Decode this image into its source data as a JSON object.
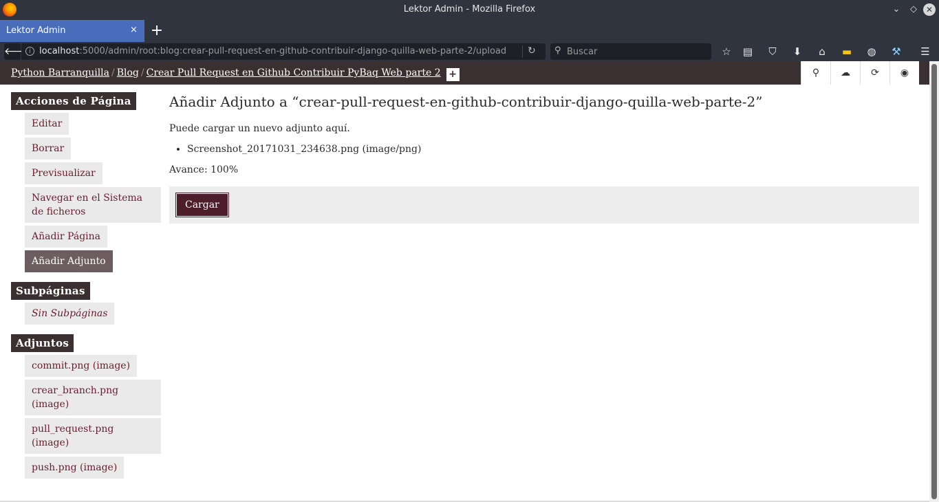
{
  "window": {
    "title": "Lektor Admin - Mozilla Firefox"
  },
  "tab": {
    "label": "Lektor Admin",
    "close": "×"
  },
  "navbar": {
    "url_host": "localhost",
    "url_path": ":5000/admin/root:blog:crear-pull-request-en-github-contribuir-django-quilla-web-parte-2/upload",
    "search_placeholder": "Buscar"
  },
  "breadcrumb": {
    "items": [
      "Python Barranquilla",
      "Blog",
      "Crear Pull Request en Github Contribuir PyBaq Web parte 2"
    ],
    "separator": "/",
    "add": "+"
  },
  "header_buttons": [
    "search-icon",
    "cloud-upload-icon",
    "refresh-icon",
    "eye-icon"
  ],
  "sidebar": {
    "page_actions": {
      "title": "Acciones de Página",
      "items": [
        "Editar",
        "Borrar",
        "Previsualizar",
        "Navegar en el Sistema de ficheros",
        "Añadir Página",
        "Añadir Adjunto"
      ]
    },
    "subpages": {
      "title": "Subpáginas",
      "empty": "Sin Subpáginas"
    },
    "attachments": {
      "title": "Adjuntos",
      "items": [
        "commit.png (image)",
        "crear_branch.png (image)",
        "pull_request.png (image)",
        "push.png (image)"
      ]
    }
  },
  "main": {
    "title": "Añadir Adjunto a “crear-pull-request-en-github-contribuir-django-quilla-web-parte-2”",
    "description": "Puede cargar un nuevo adjunto aquí.",
    "files": [
      "Screenshot_20171031_234638.png (image/png)"
    ],
    "progress": "Avance: 100%",
    "upload_button": "Cargar"
  },
  "colors": {
    "header_bg": "#3a2f31",
    "link": "#6c1b2e",
    "button_bg": "#4e1d2c",
    "active_item": "#6c5d60"
  }
}
